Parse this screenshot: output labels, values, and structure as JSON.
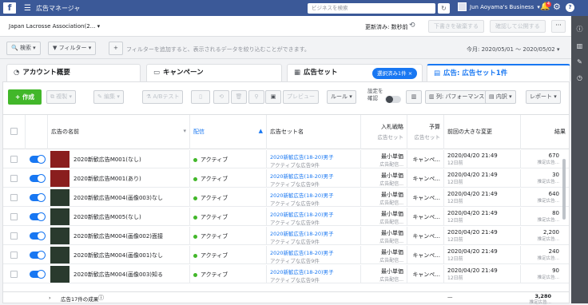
{
  "header": {
    "app_title": "広告マネージャ",
    "search_placeholder": "ビジネスを検索",
    "business_name": "Jun Aoyama's Business",
    "notification_count": "4"
  },
  "account": {
    "name": "Japan Lacrosse Association(2...",
    "sync_text": "更新済み: 数秒前",
    "discard_label": "下書きを破棄する",
    "publish_label": "確認して公開する",
    "more_label": "···"
  },
  "filters": {
    "search_label": "検索",
    "filter_label": "フィルター",
    "add_label": "+",
    "hint": "フィルターを追加すると、表示されるデータを絞り込むことができます。",
    "date_range": "今月: 2020/05/01 〜 2020/05/02"
  },
  "tabs": [
    {
      "label": "アカウント概要"
    },
    {
      "label": "キャンペーン"
    },
    {
      "label": "広告セット"
    },
    {
      "label": "広告: 広告セット1件"
    }
  ],
  "selection_chip": "選択済み1件 ×",
  "toolbar": {
    "create": "+ 作成",
    "duplicate": "複製",
    "edit": "編集",
    "ab_test": "A/Bテスト",
    "preview": "プレビュー",
    "rules": "ルール",
    "setting": "設定を確認",
    "columns": "列: パフォーマンス",
    "breakdown": "内訳",
    "report": "レポート"
  },
  "columns": {
    "name": "広告の名前",
    "delivery": "配信",
    "adset": "広告セット名",
    "bid": "入札戦略",
    "bid_sub": "広告セット",
    "budget": "予算",
    "budget_sub": "広告セット",
    "change": "前回の大きな変更",
    "results": "結果"
  },
  "rows": [
    {
      "name": "2020新歓広告M001(なし)",
      "status": "アクティブ",
      "adset": "2020新歓広告(18-20)男子",
      "adset_sub": "アクティブな広告9件",
      "bid": "最小単価",
      "bid_sub": "広告配信...",
      "budget": "キャンペ...",
      "change": "2020/04/20 21:49",
      "change_sub": "12日前",
      "result": "670",
      "result_sub": "推定広告..."
    },
    {
      "name": "2020新歓広告M001(あり)",
      "status": "アクティブ",
      "adset": "2020新歓広告(18-20)男子",
      "adset_sub": "アクティブな広告9件",
      "bid": "最小単価",
      "bid_sub": "広告配信...",
      "budget": "キャンペ...",
      "change": "2020/04/20 21:49",
      "change_sub": "12日前",
      "result": "30",
      "result_sub": "推定広告..."
    },
    {
      "name": "2020新歓広告M004(画像003)なし",
      "status": "アクティブ",
      "adset": "2020新歓広告(18-20)男子",
      "adset_sub": "アクティブな広告9件",
      "bid": "最小単価",
      "bid_sub": "広告配信...",
      "budget": "キャンペ...",
      "change": "2020/04/20 21:49",
      "change_sub": "12日前",
      "result": "640",
      "result_sub": "推定広告..."
    },
    {
      "name": "2020新歓広告M005(なし)",
      "status": "アクティブ",
      "adset": "2020新歓広告(18-20)男子",
      "adset_sub": "アクティブな広告9件",
      "bid": "最小単価",
      "bid_sub": "広告配信...",
      "budget": "キャンペ...",
      "change": "2020/04/20 21:49",
      "change_sub": "12日前",
      "result": "80",
      "result_sub": "推定広告..."
    },
    {
      "name": "2020新歓広告M004(画像002)面接",
      "status": "アクティブ",
      "adset": "2020新歓広告(18-20)男子",
      "adset_sub": "アクティブな広告9件",
      "bid": "最小単価",
      "bid_sub": "広告配信...",
      "budget": "キャンペ...",
      "change": "2020/04/20 21:49",
      "change_sub": "12日前",
      "result": "2,200",
      "result_sub": "推定広告..."
    },
    {
      "name": "2020新歓広告M004(画像001)なし",
      "status": "アクティブ",
      "adset": "2020新歓広告(18-20)男子",
      "adset_sub": "アクティブな広告9件",
      "bid": "最小単価",
      "bid_sub": "広告配信...",
      "budget": "キャンペ...",
      "change": "2020/04/20 21:49",
      "change_sub": "12日前",
      "result": "240",
      "result_sub": "推定広告..."
    },
    {
      "name": "2020新歓広告M004(画像003)知る",
      "status": "アクティブ",
      "adset": "2020新歓広告(18-20)男子",
      "adset_sub": "アクティブな広告9件",
      "bid": "最小単価",
      "bid_sub": "広告配信...",
      "budget": "キャンペ...",
      "change": "2020/04/20 21:49",
      "change_sub": "12日前",
      "result": "90",
      "result_sub": "推定広告..."
    }
  ],
  "footer": {
    "label": "広告17件の成果",
    "change": "—",
    "result": "3,280",
    "result_sub": "推定広告..."
  }
}
